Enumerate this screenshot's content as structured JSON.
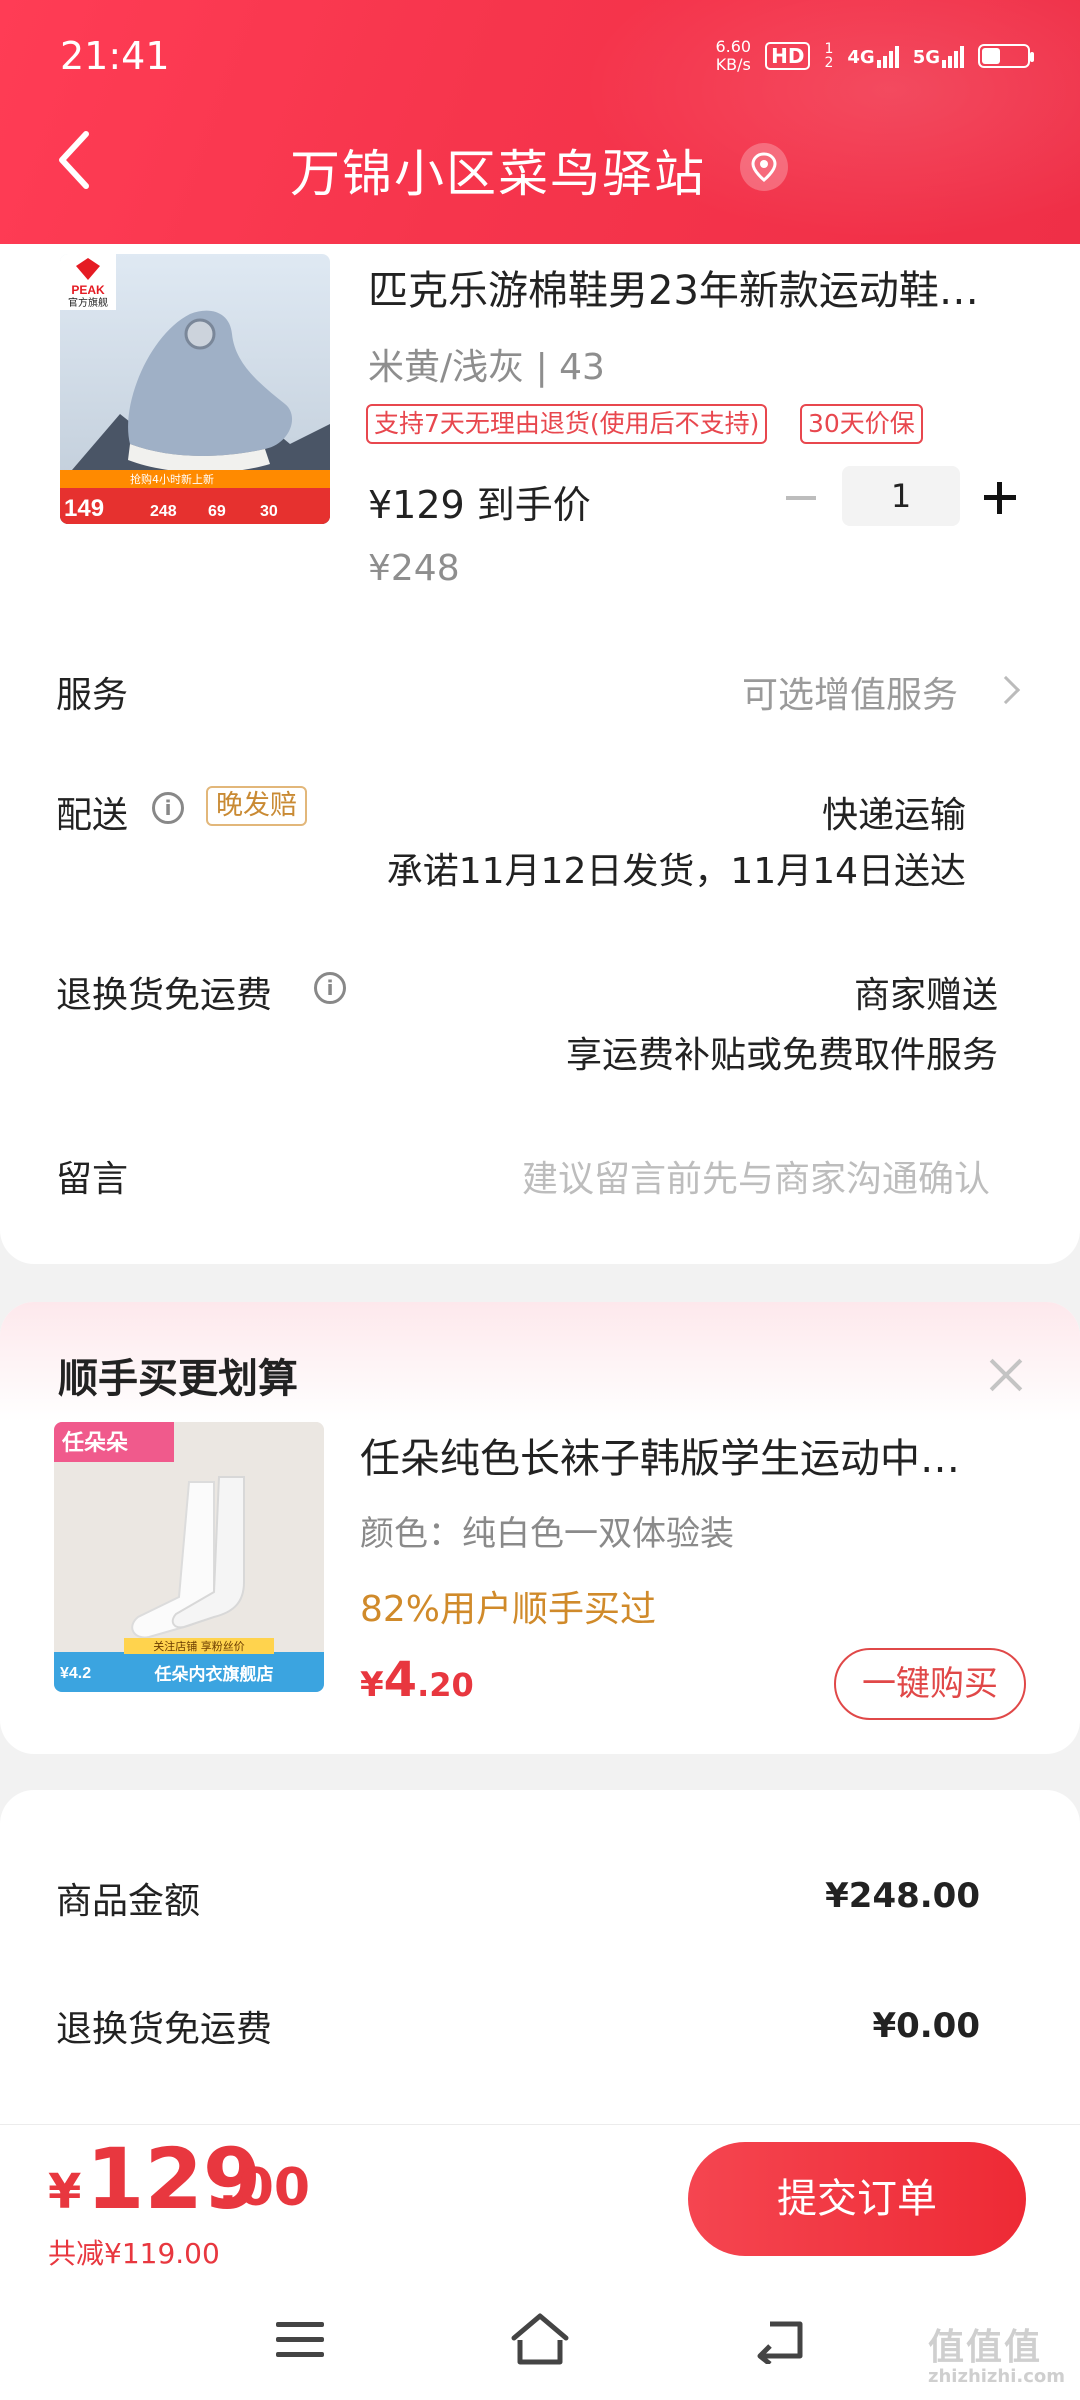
{
  "status_bar": {
    "time": "21:41",
    "net_speed": "6.60",
    "net_speed_unit": "KB/s",
    "hd_label": "HD",
    "sim_sup": "1",
    "sim_sub": "2",
    "network_1": "4G",
    "network_2": "5G",
    "battery_level": 0.4
  },
  "header": {
    "title": "万锦小区菜鸟驿站",
    "back_icon": "chevron-left-icon",
    "location_icon": "location-pin-icon"
  },
  "product": {
    "image_text": {
      "brand": "PEAK",
      "store_badge": "官方旗舰",
      "price_badge": "149",
      "strip": "抢购4小时新上新",
      "prices": [
        "248",
        "69",
        "30"
      ]
    },
    "title": "匹克乐游棉鞋男23年新款运动鞋…",
    "spec": "米黄/浅灰 | 43",
    "tags": [
      "支持7天无理由退货(使用后不支持)",
      "30天价保"
    ],
    "final_price": "¥129 到手价",
    "original_price": "¥248",
    "quantity": "1"
  },
  "rows": {
    "service_label": "服务",
    "service_value": "可选增值服务",
    "delivery_label": "配送",
    "delivery_badge": "晚发赔",
    "delivery_method": "快递运输",
    "delivery_promise": "承诺11月12日发货，11月14日送达",
    "return_label": "退换货免运费",
    "return_value": "商家赠送",
    "return_desc": "享运费补贴或免费取件服务",
    "message_label": "留言",
    "message_placeholder": "建议留言前先与商家沟通确认"
  },
  "upsell": {
    "title": "顺手买更划算",
    "image_text": {
      "brand": "任朵朵",
      "store": "任朵内衣旗舰店",
      "follow": "关注店铺 享粉丝价",
      "price": "¥4.2"
    },
    "name": "任朵纯色长袜子韩版学生运动中…",
    "spec": "颜色：纯白色一双体验装",
    "promo": "82%用户顺手买过",
    "price_currency": "¥",
    "price_int": "4",
    "price_dec": ".20",
    "buy_label": "一键购买"
  },
  "summary": {
    "goods_label": "商品金额",
    "goods_value": "¥248.00",
    "freight_label": "退换货免运费",
    "freight_value": "¥0.00"
  },
  "bottom": {
    "total_currency": "¥",
    "total_int": "129",
    "total_dec": ".00",
    "saving": "共减¥119.00",
    "submit_label": "提交订单"
  },
  "watermark": {
    "main": "值值值",
    "sub": "zhizhizhi.com"
  },
  "colors": {
    "header_bg": "#f6354c",
    "accent_red": "#e8373f",
    "promo_orange": "#d08a2a"
  }
}
